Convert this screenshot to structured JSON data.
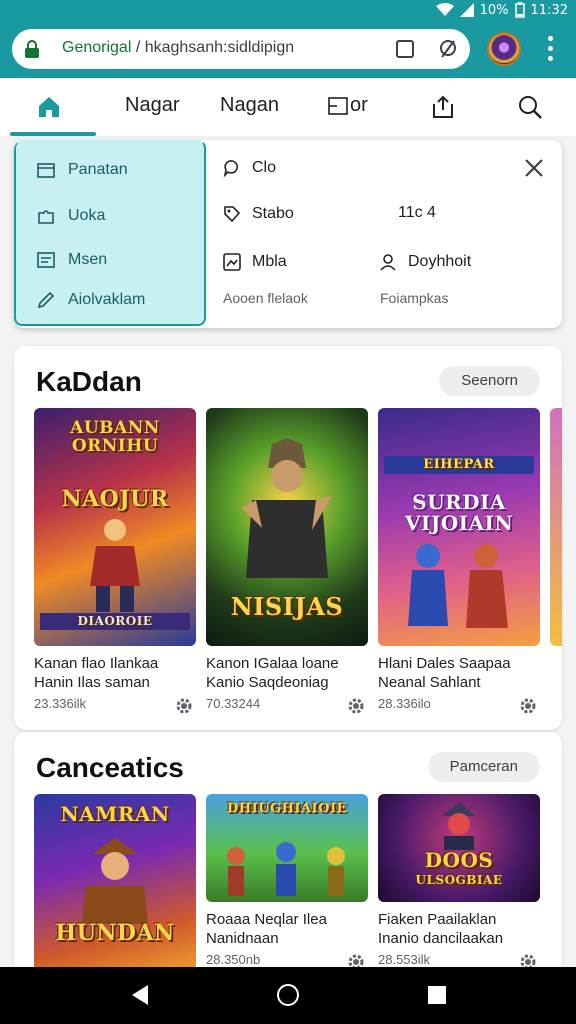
{
  "status_bar": {
    "battery": "10%",
    "time": "11:32"
  },
  "browser": {
    "url_domain": "Genorigal",
    "url_path": " / hkaghsanh:sidldipign",
    "avatar_colors": [
      "#5a2a80",
      "#e0a040"
    ]
  },
  "top_nav": {
    "items": [
      {
        "label": "Nagar"
      },
      {
        "label": "Nagan"
      },
      {
        "label": "or"
      }
    ],
    "accent": "#1a9aa0"
  },
  "menu": {
    "left_items": [
      {
        "label": "Panatan",
        "icon": "card-icon"
      },
      {
        "label": "Uoka",
        "icon": "puzzle-icon"
      },
      {
        "label": "Msen",
        "icon": "list-icon"
      },
      {
        "label": "Aiolvaklam",
        "icon": "pen-icon"
      }
    ],
    "right_items": [
      {
        "label": "Clo",
        "icon": "chat-icon"
      },
      {
        "label": "Stabo",
        "icon": "tag-icon"
      },
      {
        "label": "11c 4",
        "icon": ""
      },
      {
        "label": "Mbla",
        "icon": "image-icon"
      },
      {
        "label": "Doyhhoit",
        "icon": "person-icon"
      }
    ],
    "footer": [
      "Aooen flelaok",
      "Foiampkas"
    ]
  },
  "sections": [
    {
      "title": "KaDdan",
      "see_more": "Seenorn",
      "cards": [
        {
          "cover_text_top": "AUBANN ORNIHU",
          "cover_text_mid": "NAOJUR",
          "cover_text_bottom": "DIAOROIE",
          "title_line1": "Kanan flao Ilankaa",
          "title_line2": "Hanin Ilas saman",
          "meta": "23.336ilk"
        },
        {
          "cover_text_top": "",
          "cover_text_mid": "",
          "cover_text_bottom": "NISIJAS",
          "title_line1": "Kanon IGalaa loane",
          "title_line2": "Kanio Saqdeoniag",
          "meta": "70.33244"
        },
        {
          "cover_text_top": "EIHEPAR",
          "cover_text_mid": "SURDIA VIJOIAIN",
          "cover_text_bottom": "",
          "title_line1": "Hlani Dales Saapaa",
          "title_line2": "Neanal Sahlant",
          "meta": "28.336ilo"
        }
      ]
    },
    {
      "title": "Canceatics",
      "see_more": "Pamceran",
      "cards": [
        {
          "cover_text_top": "NAMRAN",
          "cover_text_bottom": "HUNDAN",
          "title_line1": "",
          "title_line2": "",
          "meta": ""
        },
        {
          "cover_text_top": "DHIUGHIAIOIE",
          "cover_text_bottom": "",
          "title_line1": "Roaaa Neqlar Ilea",
          "title_line2": "Nanidnaan",
          "meta": "28.350nb"
        },
        {
          "cover_text_top": "DOOS",
          "cover_text_bottom": "ULSOGBIAE",
          "title_line1": "Fiaken Paailaklan",
          "title_line2": "Inanio dancilaakan",
          "meta": "28.553ilk"
        }
      ]
    }
  ]
}
